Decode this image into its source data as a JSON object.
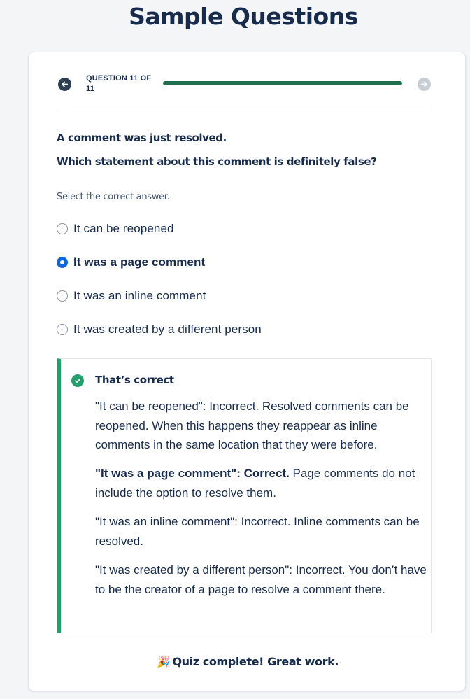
{
  "page_title": "Sample Questions",
  "progress": {
    "counter_label": "QUESTION 11 OF 11",
    "current": 11,
    "total": 11,
    "fill_fraction": 1.0,
    "fill_color": "#1f6e4e"
  },
  "question": {
    "title": "A comment was just resolved.",
    "prompt": "Which statement about this comment is definitely false?",
    "instruction": "Select the correct answer."
  },
  "options": [
    {
      "label": "It can be reopened",
      "selected": false
    },
    {
      "label": "It was a page comment",
      "selected": true
    },
    {
      "label": "It was an inline comment",
      "selected": false
    },
    {
      "label": "It was created by a different person",
      "selected": false
    }
  ],
  "feedback": {
    "title": "That’s correct",
    "accent_color": "#22a06b",
    "paragraphs": [
      {
        "lead": "",
        "text": "\"It can be reopened\": Incorrect. Resolved comments can be reopened. When this happens they reappear as inline comments in the same location that they were before."
      },
      {
        "lead": "\"It was a page comment\": Correct.",
        "text": " Page comments do not include the option to resolve them."
      },
      {
        "lead": "",
        "text": "\"It was an inline comment\": Incorrect. Inline comments can be resolved."
      },
      {
        "lead": "",
        "text": "\"It was created by a different person\": Incorrect. You don’t have to be the creator of a page to resolve a comment there."
      }
    ]
  },
  "completion": {
    "icon": "🎉",
    "text": "Quiz complete! Great work."
  },
  "icons": {
    "prev": "arrow-left-icon",
    "next": "arrow-right-icon",
    "check": "check-circle-icon",
    "party": "party-popper-icon"
  }
}
